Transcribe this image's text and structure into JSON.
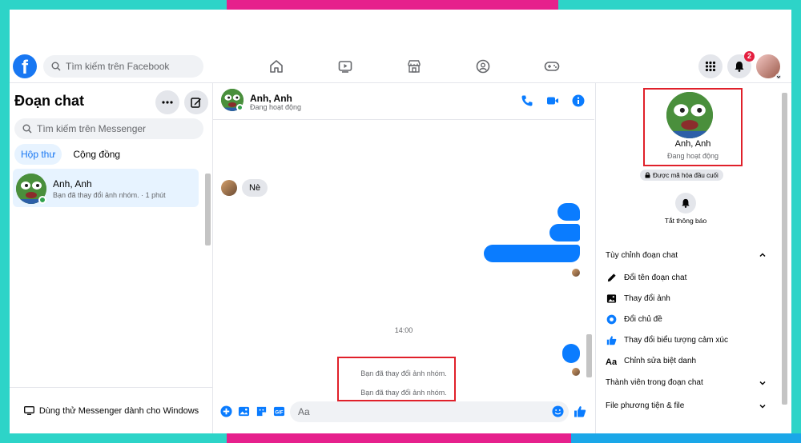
{
  "topbar": {
    "logo_letter": "f",
    "search_placeholder": "Tìm kiếm trên Facebook",
    "nav_icons": [
      "home-icon",
      "video-icon",
      "marketplace-icon",
      "groups-icon",
      "gaming-icon"
    ],
    "notification_count": "2"
  },
  "sidebar": {
    "title": "Đoạn chat",
    "search_placeholder": "Tìm kiếm trên Messenger",
    "tabs": [
      "Hộp thư",
      "Cộng đồng"
    ],
    "conversation": {
      "name": "Anh, Anh",
      "preview": "Bạn đã thay đổi ảnh nhóm. · 1 phút"
    },
    "bottom_link": "Dùng thử Messenger dành cho Windows"
  },
  "chat": {
    "name": "Anh, Anh",
    "status": "Đang hoạt động",
    "incoming_text": "Nè",
    "time_separator": "14:00",
    "system_messages": [
      "Bạn đã thay đổi ảnh nhóm.",
      "Bạn đã thay đổi ảnh nhóm."
    ],
    "input_placeholder": "Aa"
  },
  "info": {
    "name": "Anh, Anh",
    "status": "Đang hoạt động",
    "e2e_label": "Được mã hóa đầu cuối",
    "mute_label": "Tắt thông báo",
    "section_customize": "Tùy chỉnh đoạn chat",
    "options": [
      {
        "icon": "pencil-icon",
        "label": "Đổi tên đoạn chat"
      },
      {
        "icon": "image-icon",
        "label": "Thay đổi ảnh"
      },
      {
        "icon": "theme-icon",
        "label": "Đổi chủ đề"
      },
      {
        "icon": "like-icon",
        "label": "Thay đổi biểu tượng cảm xúc"
      },
      {
        "icon": "nickname-icon",
        "label": "Chỉnh sửa biệt danh"
      }
    ],
    "section_members": "Thành viên trong đoạn chat",
    "section_media": "File phương tiện & file"
  },
  "colors": {
    "accent": "#1877f2",
    "bubble_out": "#0a7cff",
    "highlight_box": "#e0202a"
  }
}
